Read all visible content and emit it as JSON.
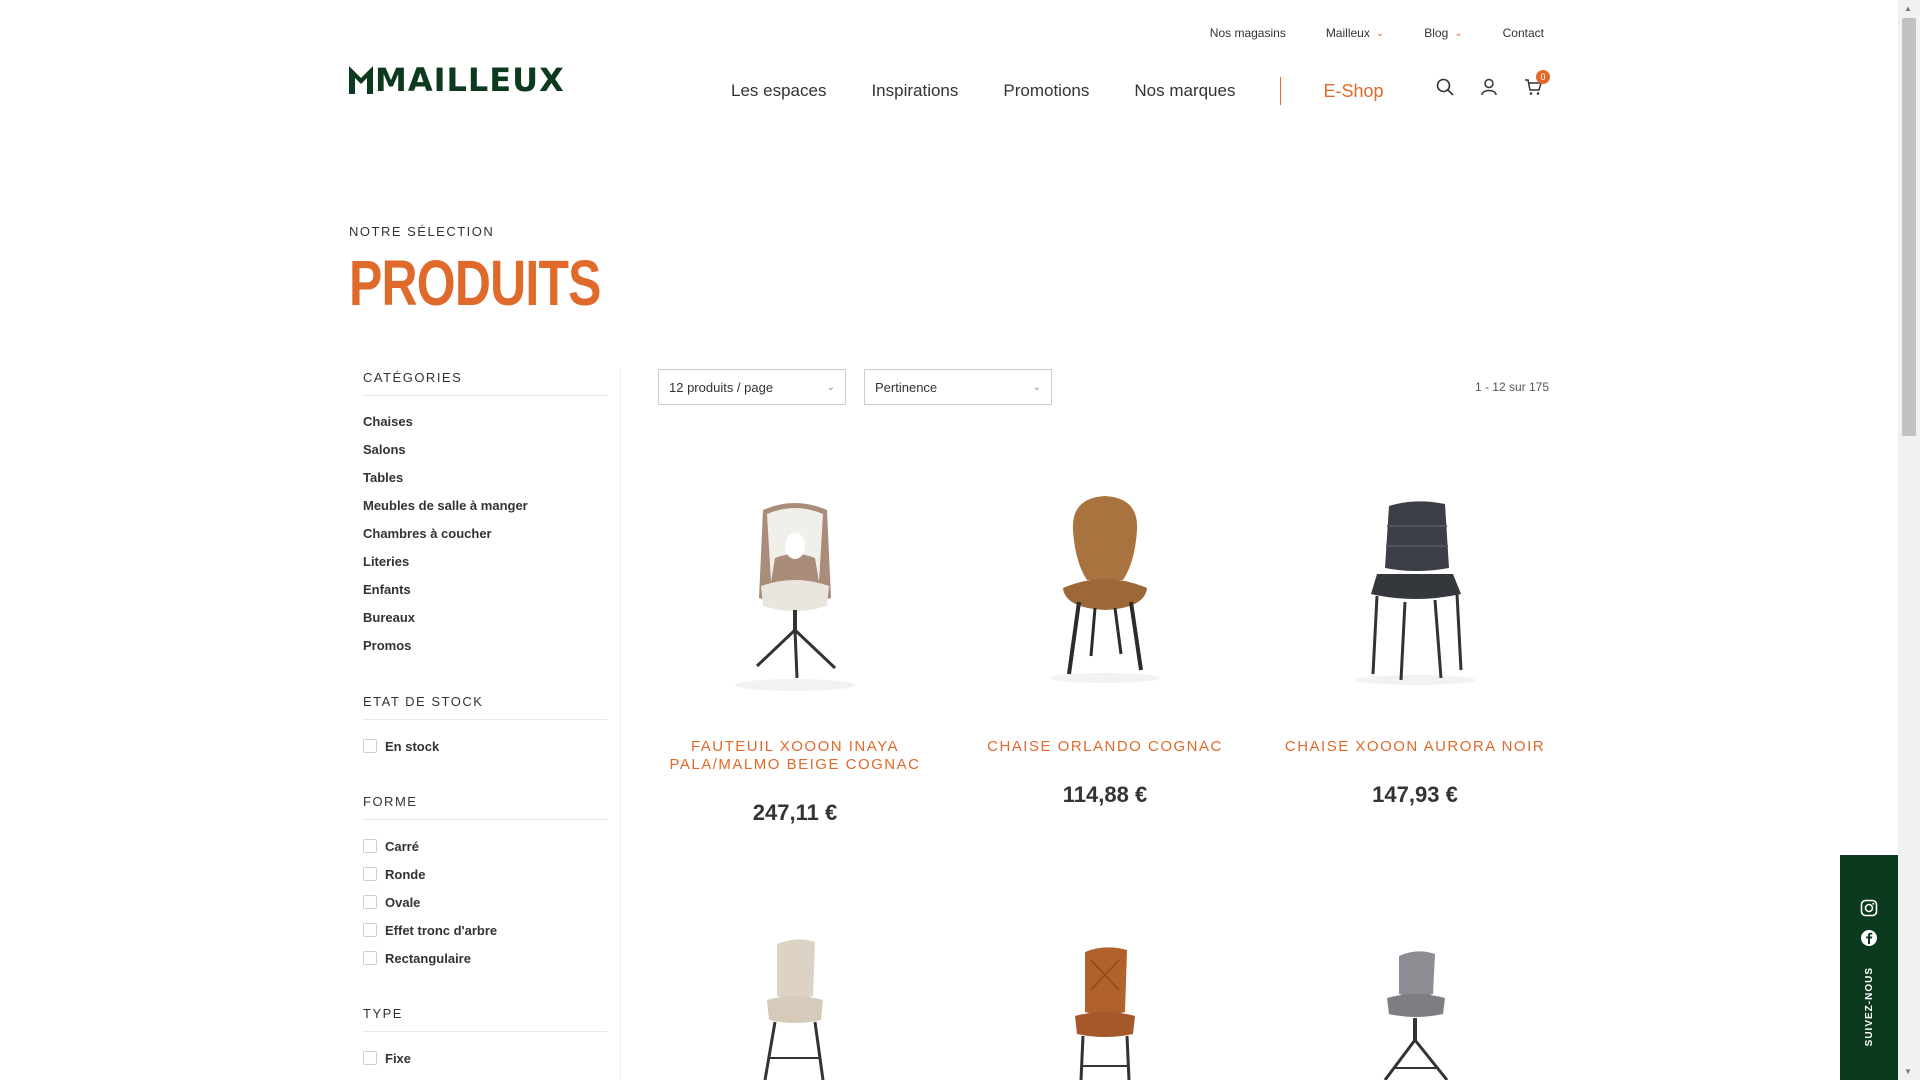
{
  "topbar": {
    "stores": "Nos magasins",
    "mailleux": "Mailleux",
    "blog": "Blog",
    "contact": "Contact"
  },
  "logo": {
    "text": "MAILLEUX"
  },
  "nav": {
    "items": [
      "Les espaces",
      "Inspirations",
      "Promotions",
      "Nos marques"
    ],
    "eshop": "E-Shop",
    "cart_count": "0"
  },
  "heading": {
    "kicker": "NOTRE SÉLECTION",
    "title": "PRODUITS"
  },
  "sidebar": {
    "categories_title": "CATÉGORIES",
    "categories": [
      "Chaises",
      "Salons",
      "Tables",
      "Meubles de salle à manger",
      "Chambres à coucher",
      "Literies",
      "Enfants",
      "Bureaux",
      "Promos"
    ],
    "stock_title": "ETAT DE STOCK",
    "stock_options": [
      "En stock"
    ],
    "shape_title": "FORME",
    "shape_options": [
      "Carré",
      "Ronde",
      "Ovale",
      "Effet tronc d'arbre",
      "Rectangulaire"
    ],
    "type_title": "TYPE",
    "type_options": [
      "Fixe"
    ]
  },
  "toolbar": {
    "per_page": "12 produits / page",
    "sort": "Pertinence",
    "count": "1 - 12 sur 175"
  },
  "products": [
    {
      "name": "FAUTEUIL XOOON INAYA PALA/MALMO BEIGE COGNAC",
      "price": "247,11 €"
    },
    {
      "name": "CHAISE ORLANDO COGNAC",
      "price": "114,88 €"
    },
    {
      "name": "CHAISE XOOON AURORA NOIR",
      "price": "147,93 €"
    }
  ],
  "follow": {
    "label": "SUIVEZ-NOUS"
  },
  "colors": {
    "accent": "#e06a2c",
    "brand_green": "#0b3a1e"
  }
}
